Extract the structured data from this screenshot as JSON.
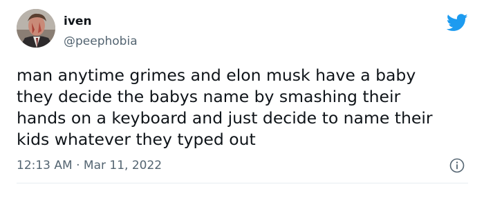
{
  "tweet": {
    "author": {
      "display_name": "iven",
      "handle": "@peephobia"
    },
    "text_lines": [
      "man anytime grimes and elon musk have a baby",
      "they decide the babys name by smashing their",
      "hands on a keyboard and just decide to name their",
      "kids whatever they typed out"
    ],
    "time": "12:13 AM",
    "separator": "·",
    "date": "Mar 11, 2022"
  },
  "icons": {
    "brand": "twitter-bird-icon",
    "info": "info-icon"
  },
  "colors": {
    "brand_blue": "#1d9bf0",
    "text": "#0f1419",
    "secondary_text": "#536471",
    "divider": "#e6ecf0"
  }
}
